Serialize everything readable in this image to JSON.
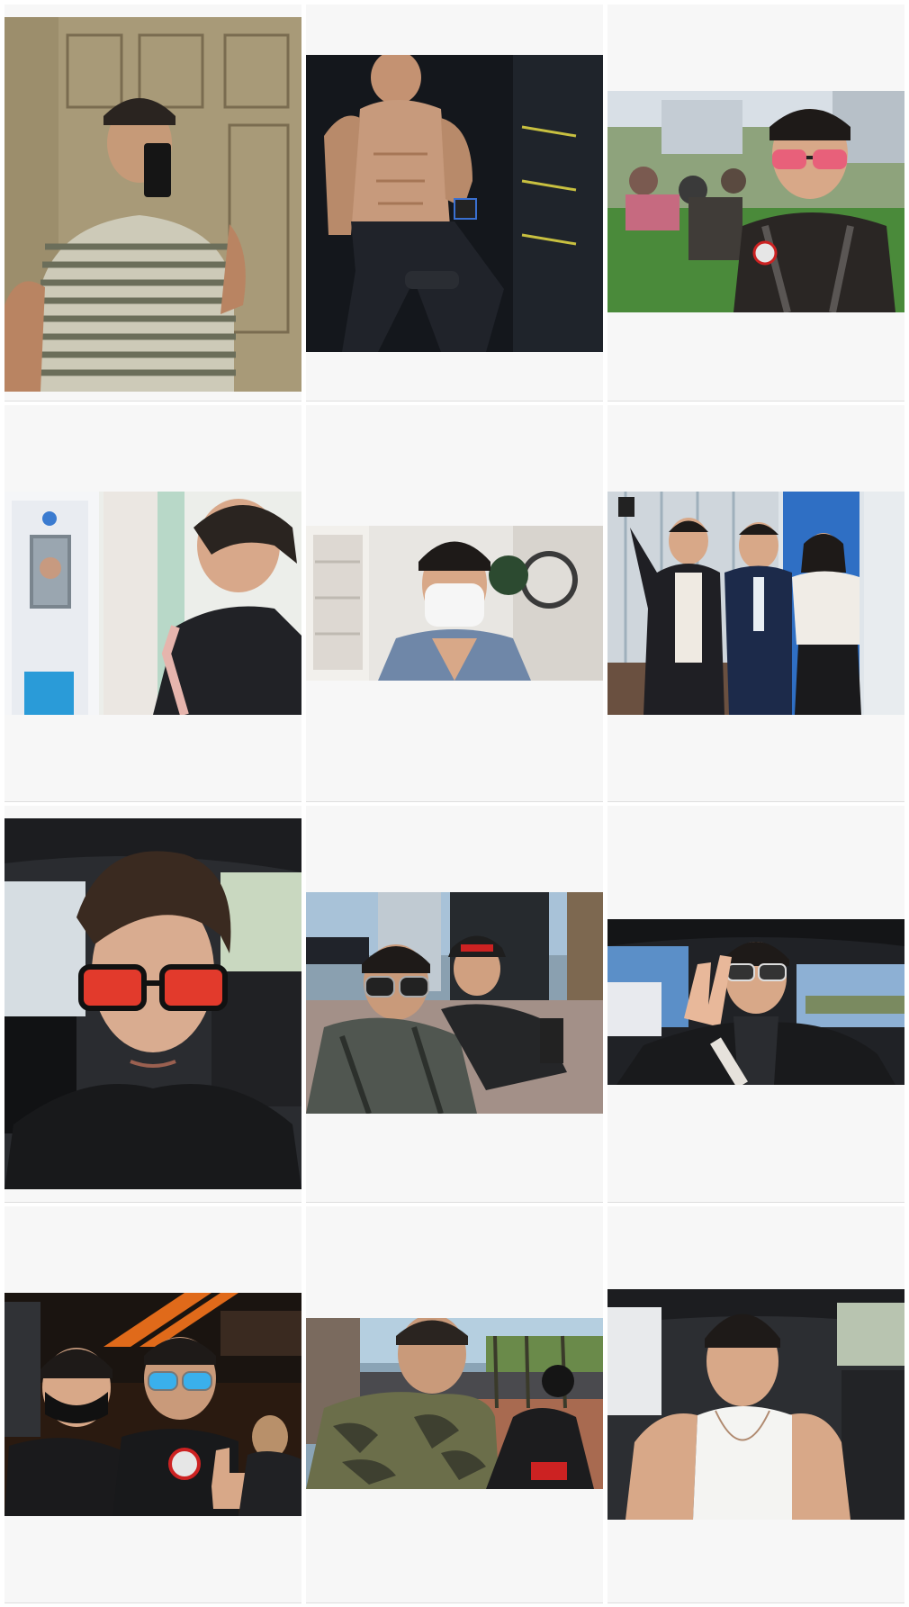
{
  "grid": {
    "columns": 3,
    "rows": 4,
    "posts": [
      {
        "subject": "mirror-selfie-striped-shirt"
      },
      {
        "subject": "gym-shirtless-portrait"
      },
      {
        "subject": "outdoor-event-red-sunglasses"
      },
      {
        "subject": "face-id-check-in-kiosk"
      },
      {
        "subject": "selfie-white-face-mask"
      },
      {
        "subject": "group-photo-office-lobby"
      },
      {
        "subject": "car-selfie-red-sunglasses"
      },
      {
        "subject": "selfie-with-friend-outside-shop"
      },
      {
        "subject": "car-selfie-peace-sign"
      },
      {
        "subject": "motorcycle-club-thumbs-up"
      },
      {
        "subject": "street-selfie-camo-jacket"
      },
      {
        "subject": "car-selfie-white-tank-top"
      }
    ]
  }
}
